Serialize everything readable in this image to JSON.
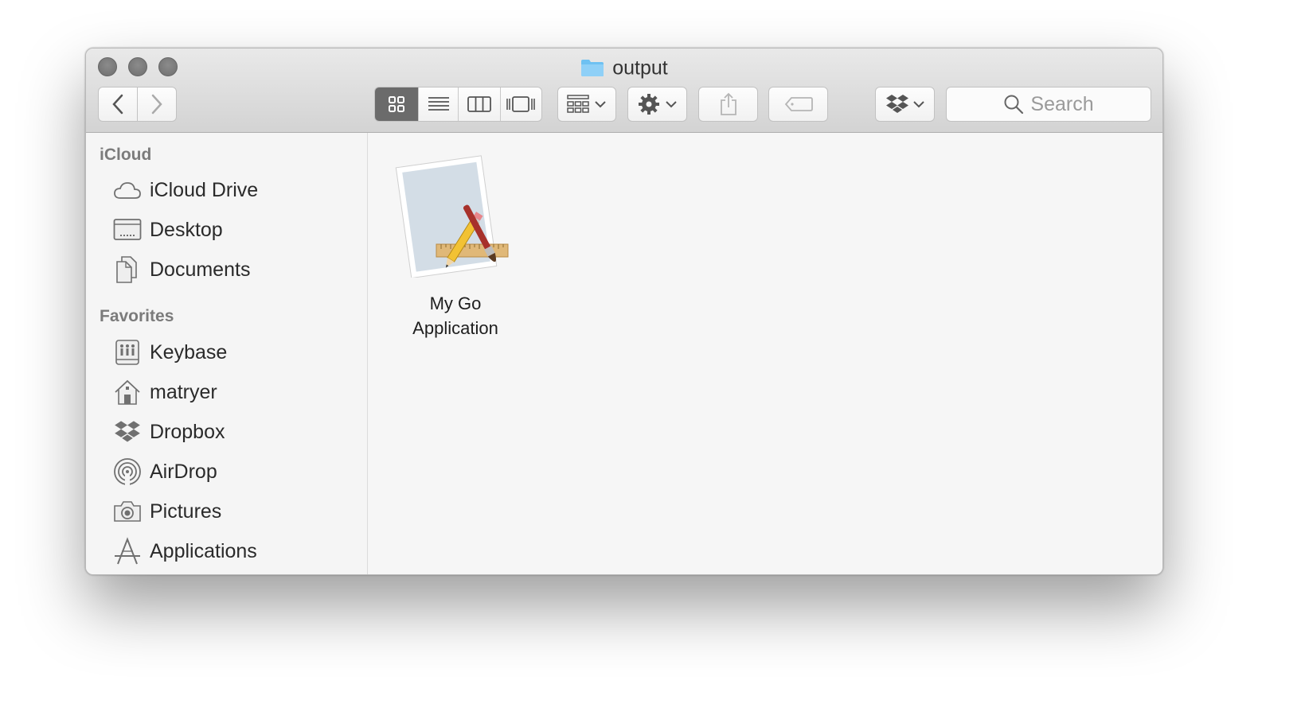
{
  "window": {
    "title": "output"
  },
  "toolbar": {
    "back_icon": "chevron-left-icon",
    "forward_icon": "chevron-right-icon",
    "view_modes": [
      "icon-view",
      "list-view",
      "column-view",
      "cover-flow-view"
    ],
    "active_view": "icon-view",
    "group_icon": "arrange-grid-icon",
    "action_icon": "gear-icon",
    "share_icon": "share-icon",
    "tags_icon": "tag-icon",
    "dropbox_icon": "dropbox-icon",
    "search_placeholder": "Search"
  },
  "sidebar": {
    "sections": [
      {
        "title": "iCloud",
        "items": [
          {
            "label": "iCloud Drive",
            "icon": "cloud-icon"
          },
          {
            "label": "Desktop",
            "icon": "desktop-icon"
          },
          {
            "label": "Documents",
            "icon": "documents-icon"
          }
        ]
      },
      {
        "title": "Favorites",
        "items": [
          {
            "label": "Keybase",
            "icon": "keybase-drive-icon"
          },
          {
            "label": "matryer",
            "icon": "home-icon"
          },
          {
            "label": "Dropbox",
            "icon": "dropbox-icon"
          },
          {
            "label": "AirDrop",
            "icon": "airdrop-icon"
          },
          {
            "label": "Pictures",
            "icon": "camera-icon"
          },
          {
            "label": "Applications",
            "icon": "applications-icon"
          }
        ]
      }
    ]
  },
  "files": [
    {
      "name_line1": "My Go",
      "name_line2": "Application",
      "icon": "application-icon"
    }
  ],
  "colors": {
    "folder_blue": "#6ec1f2",
    "active_segment": "#6b6b6b"
  }
}
